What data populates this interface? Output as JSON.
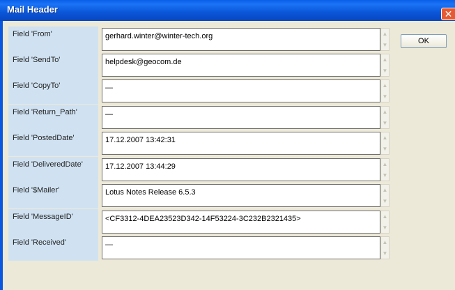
{
  "window": {
    "title": "Mail Header",
    "close_glyph": "✕",
    "close_icon": "close-icon"
  },
  "fields": [
    {
      "label": "Field 'From'",
      "value": "gerhard.winter@winter-tech.org"
    },
    {
      "label": "Field 'SendTo'",
      "value": "helpdesk@geocom.de"
    },
    {
      "label": "Field 'CopyTo'",
      "value": "—"
    },
    {
      "label": "Field 'Return_Path'",
      "value": "—"
    },
    {
      "label": "Field 'PostedDate'",
      "value": "17.12.2007 13:42:31"
    },
    {
      "label": "Field 'DeliveredDate'",
      "value": "17.12.2007 13:44:29"
    },
    {
      "label": "Field '$Mailer'",
      "value": "Lotus Notes Release 6.5.3"
    },
    {
      "label": "Field 'MessageID'",
      "value": "<CF3312-4DEA23523D342-14F53224-3C232B2321435>"
    },
    {
      "label": "Field 'Received'",
      "value": "—"
    }
  ],
  "scroll_icons": {
    "up": "scroll-up-arrow-icon",
    "down": "scroll-down-arrow-icon",
    "up_glyph": "▲",
    "down_glyph": "▼"
  },
  "ok_label": "OK",
  "colors": {
    "titlebar": "#0a56d8",
    "label_bg": "#d0e2f2",
    "dialog_bg": "#ece9d8",
    "close_bg": "#e45a32"
  }
}
